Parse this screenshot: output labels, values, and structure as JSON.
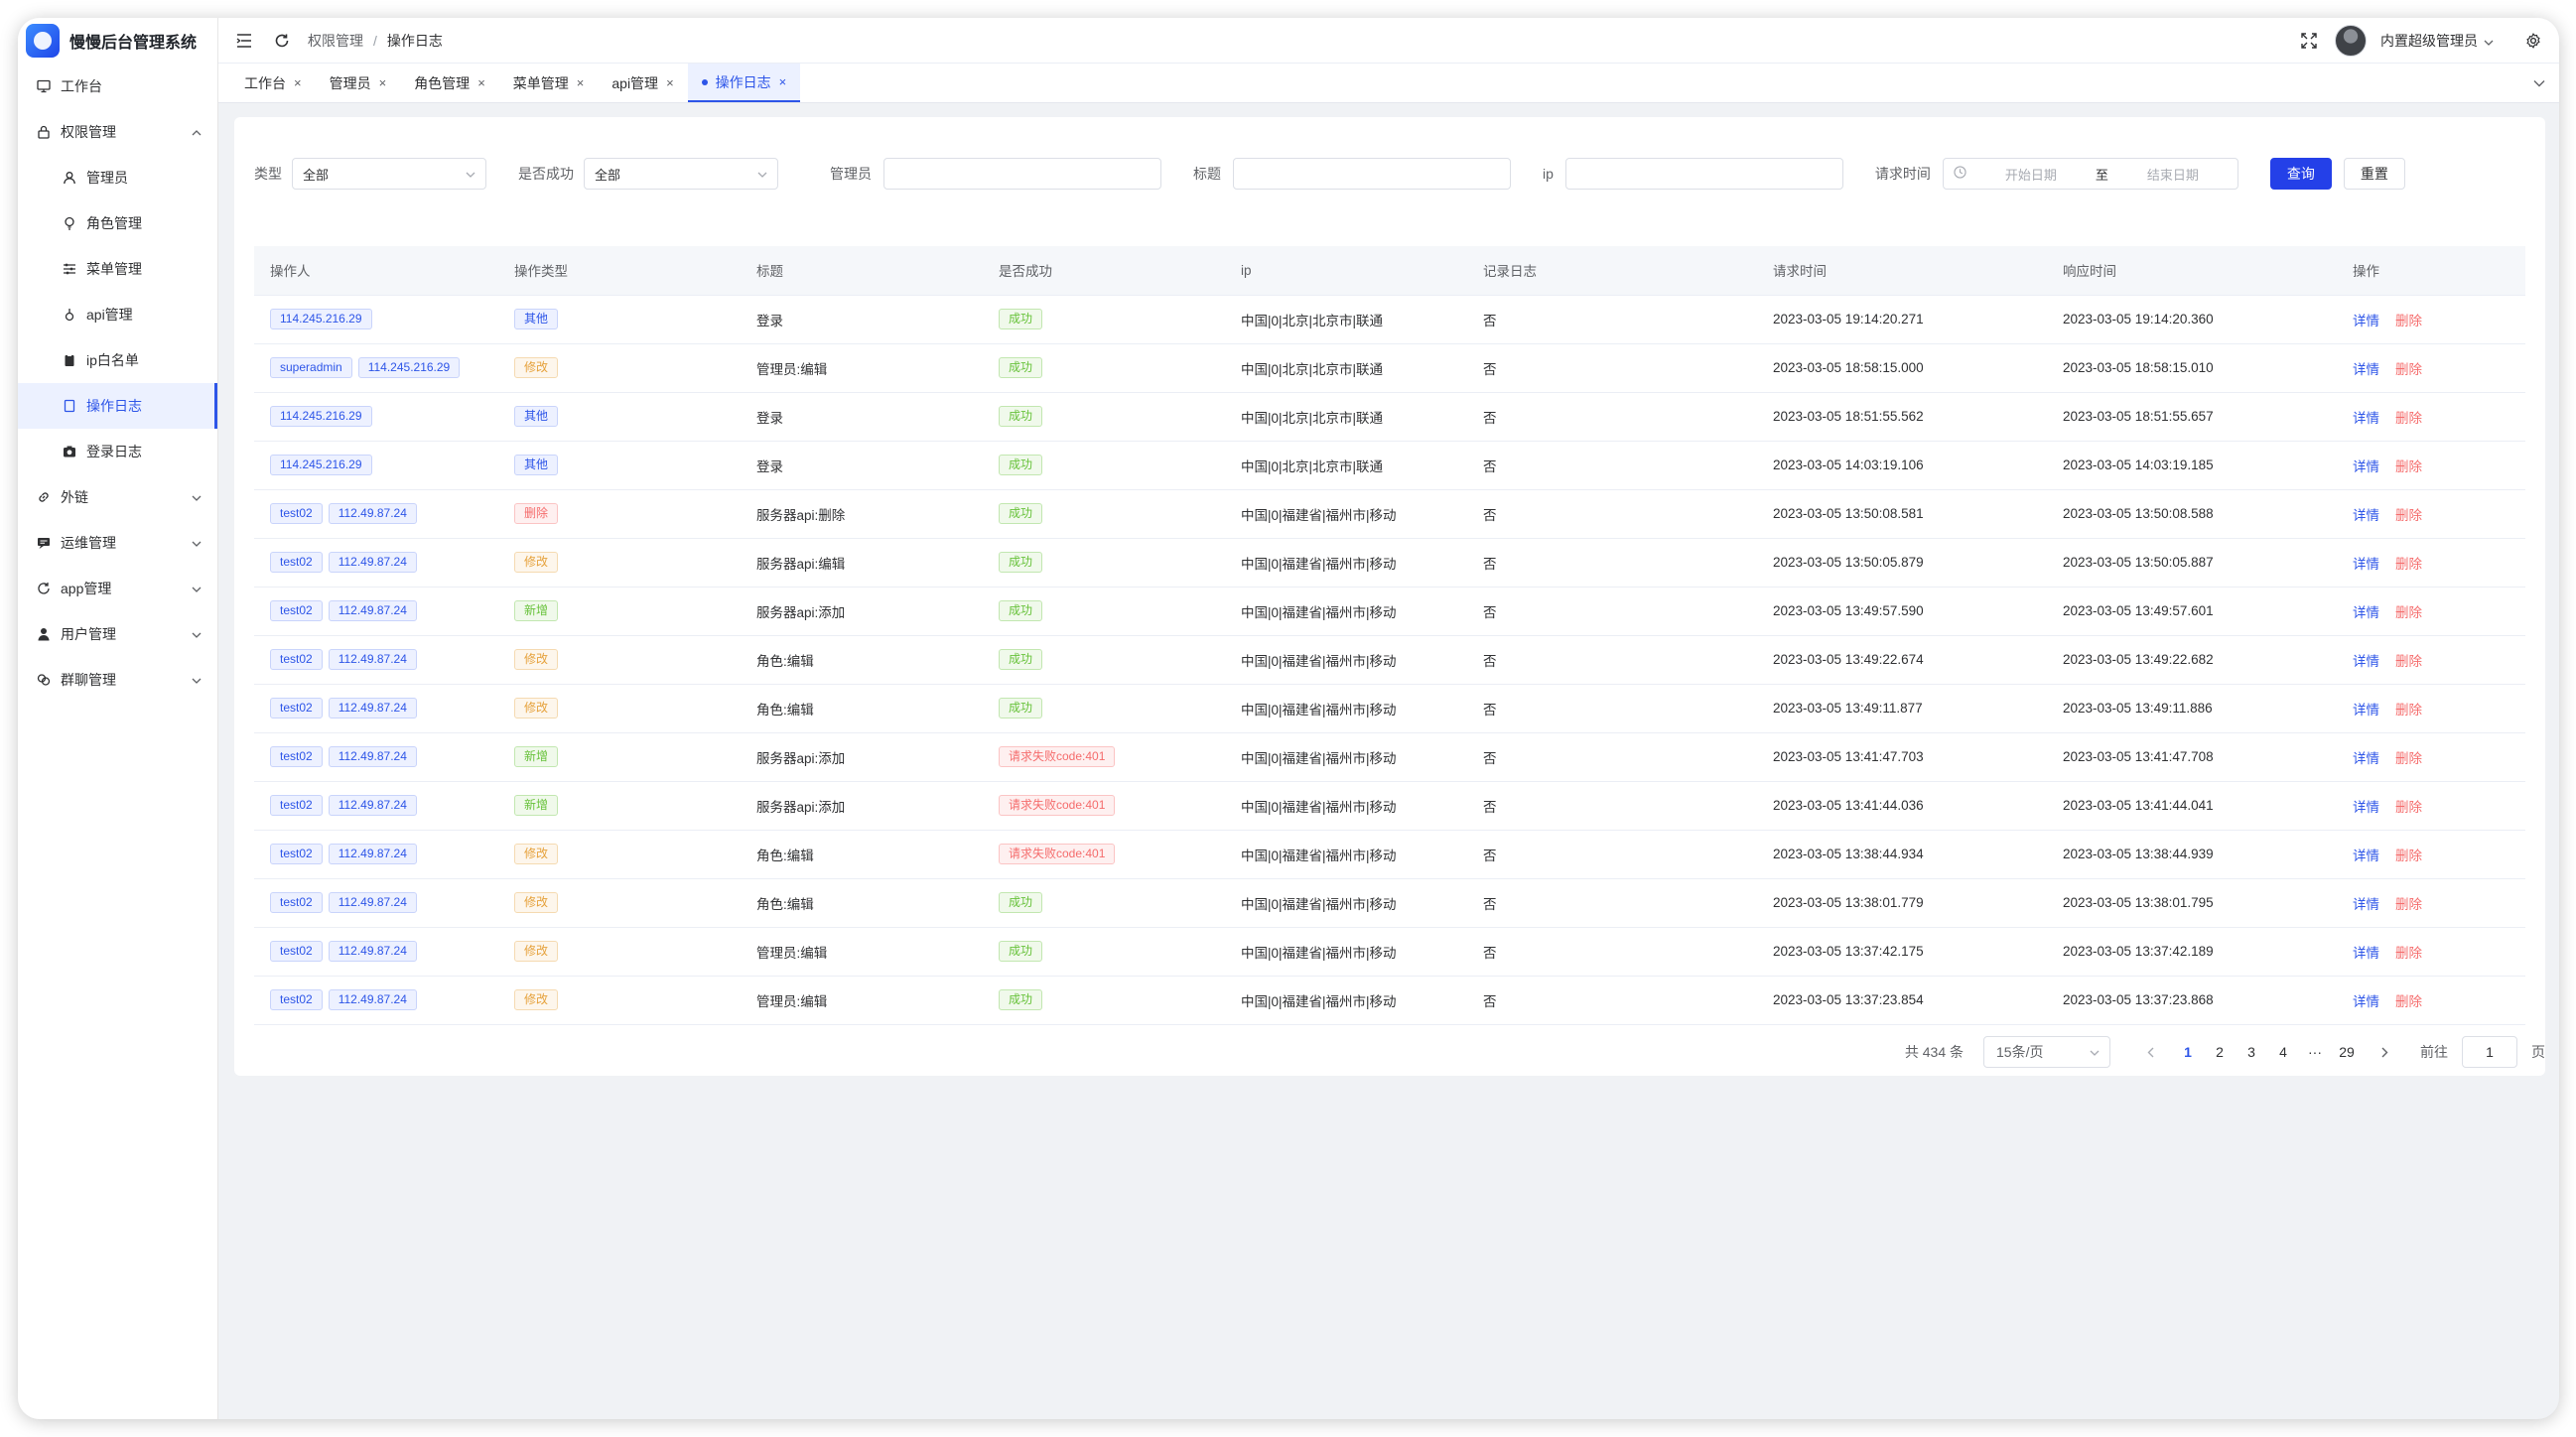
{
  "app": {
    "brand": "慢慢后台管理系统",
    "accent": "#2d55e8"
  },
  "sidebar": {
    "items": [
      {
        "label": "工作台",
        "icon": "monitor-icon",
        "level": 0,
        "active": false,
        "expandable": false
      },
      {
        "label": "权限管理",
        "icon": "lock-icon",
        "level": 0,
        "active": false,
        "expandable": true,
        "expanded": true
      },
      {
        "label": "管理员",
        "icon": "user-icon",
        "level": 1,
        "active": false
      },
      {
        "label": "角色管理",
        "icon": "bulb-icon",
        "level": 1,
        "active": false
      },
      {
        "label": "菜单管理",
        "icon": "sliders-icon",
        "level": 1,
        "active": false
      },
      {
        "label": "api管理",
        "icon": "pin-icon",
        "level": 1,
        "active": false
      },
      {
        "label": "ip白名单",
        "icon": "clipboard-icon",
        "level": 1,
        "active": false
      },
      {
        "label": "操作日志",
        "icon": "document-icon",
        "level": 1,
        "active": true
      },
      {
        "label": "登录日志",
        "icon": "camera-icon",
        "level": 1,
        "active": false
      },
      {
        "label": "外链",
        "icon": "link-icon",
        "level": 0,
        "active": false,
        "expandable": true
      },
      {
        "label": "运维管理",
        "icon": "message-icon",
        "level": 0,
        "active": false,
        "expandable": true
      },
      {
        "label": "app管理",
        "icon": "refresh-icon",
        "level": 0,
        "active": false,
        "expandable": true
      },
      {
        "label": "用户管理",
        "icon": "person-icon",
        "level": 0,
        "active": false,
        "expandable": true
      },
      {
        "label": "群聊管理",
        "icon": "chat-icon",
        "level": 0,
        "active": false,
        "expandable": true
      }
    ]
  },
  "header": {
    "breadcrumb": [
      "权限管理",
      "操作日志"
    ],
    "user": "内置超级管理员"
  },
  "tabs": [
    {
      "label": "工作台",
      "active": false
    },
    {
      "label": "管理员",
      "active": false
    },
    {
      "label": "角色管理",
      "active": false
    },
    {
      "label": "菜单管理",
      "active": false
    },
    {
      "label": "api管理",
      "active": false
    },
    {
      "label": "操作日志",
      "active": true
    }
  ],
  "filters": {
    "type_label": "类型",
    "type_value": "全部",
    "success_label": "是否成功",
    "success_value": "全部",
    "admin_label": "管理员",
    "admin_value": "",
    "title_label": "标题",
    "title_value": "",
    "ip_label": "ip",
    "ip_value": "",
    "time_label": "请求时间",
    "start_placeholder": "开始日期",
    "to": "至",
    "end_placeholder": "结束日期",
    "query_label": "查询",
    "reset_label": "重置"
  },
  "table": {
    "columns": [
      "操作人",
      "操作类型",
      "标题",
      "是否成功",
      "ip",
      "记录日志",
      "请求时间",
      "响应时间",
      "操作"
    ],
    "detail_label": "详情",
    "delete_label": "删除",
    "rows": [
      {
        "user": "",
        "ip": "114.245.216.29",
        "type": "其他",
        "type_color": "purple",
        "title": "登录",
        "success": "成功",
        "success_color": "green",
        "location": "中国|0|北京|北京市|联通",
        "log": "否",
        "req": "2023-03-05 19:14:20.271",
        "resp": "2023-03-05 19:14:20.360"
      },
      {
        "user": "superadmin",
        "ip": "114.245.216.29",
        "type": "修改",
        "type_color": "orange",
        "title": "管理员:编辑",
        "success": "成功",
        "success_color": "green",
        "location": "中国|0|北京|北京市|联通",
        "log": "否",
        "req": "2023-03-05 18:58:15.000",
        "resp": "2023-03-05 18:58:15.010"
      },
      {
        "user": "",
        "ip": "114.245.216.29",
        "type": "其他",
        "type_color": "purple",
        "title": "登录",
        "success": "成功",
        "success_color": "green",
        "location": "中国|0|北京|北京市|联通",
        "log": "否",
        "req": "2023-03-05 18:51:55.562",
        "resp": "2023-03-05 18:51:55.657"
      },
      {
        "user": "",
        "ip": "114.245.216.29",
        "type": "其他",
        "type_color": "purple",
        "title": "登录",
        "success": "成功",
        "success_color": "green",
        "location": "中国|0|北京|北京市|联通",
        "log": "否",
        "req": "2023-03-05 14:03:19.106",
        "resp": "2023-03-05 14:03:19.185"
      },
      {
        "user": "test02",
        "ip": "112.49.87.24",
        "type": "删除",
        "type_color": "red",
        "title": "服务器api:删除",
        "success": "成功",
        "success_color": "green",
        "location": "中国|0|福建省|福州市|移动",
        "log": "否",
        "req": "2023-03-05 13:50:08.581",
        "resp": "2023-03-05 13:50:08.588"
      },
      {
        "user": "test02",
        "ip": "112.49.87.24",
        "type": "修改",
        "type_color": "orange",
        "title": "服务器api:编辑",
        "success": "成功",
        "success_color": "green",
        "location": "中国|0|福建省|福州市|移动",
        "log": "否",
        "req": "2023-03-05 13:50:05.879",
        "resp": "2023-03-05 13:50:05.887"
      },
      {
        "user": "test02",
        "ip": "112.49.87.24",
        "type": "新增",
        "type_color": "green",
        "title": "服务器api:添加",
        "success": "成功",
        "success_color": "green",
        "location": "中国|0|福建省|福州市|移动",
        "log": "否",
        "req": "2023-03-05 13:49:57.590",
        "resp": "2023-03-05 13:49:57.601"
      },
      {
        "user": "test02",
        "ip": "112.49.87.24",
        "type": "修改",
        "type_color": "orange",
        "title": "角色:编辑",
        "success": "成功",
        "success_color": "green",
        "location": "中国|0|福建省|福州市|移动",
        "log": "否",
        "req": "2023-03-05 13:49:22.674",
        "resp": "2023-03-05 13:49:22.682"
      },
      {
        "user": "test02",
        "ip": "112.49.87.24",
        "type": "修改",
        "type_color": "orange",
        "title": "角色:编辑",
        "success": "成功",
        "success_color": "green",
        "location": "中国|0|福建省|福州市|移动",
        "log": "否",
        "req": "2023-03-05 13:49:11.877",
        "resp": "2023-03-05 13:49:11.886"
      },
      {
        "user": "test02",
        "ip": "112.49.87.24",
        "type": "新增",
        "type_color": "green",
        "title": "服务器api:添加",
        "success": "请求失败code:401",
        "success_color": "red",
        "location": "中国|0|福建省|福州市|移动",
        "log": "否",
        "req": "2023-03-05 13:41:47.703",
        "resp": "2023-03-05 13:41:47.708"
      },
      {
        "user": "test02",
        "ip": "112.49.87.24",
        "type": "新增",
        "type_color": "green",
        "title": "服务器api:添加",
        "success": "请求失败code:401",
        "success_color": "red",
        "location": "中国|0|福建省|福州市|移动",
        "log": "否",
        "req": "2023-03-05 13:41:44.036",
        "resp": "2023-03-05 13:41:44.041"
      },
      {
        "user": "test02",
        "ip": "112.49.87.24",
        "type": "修改",
        "type_color": "orange",
        "title": "角色:编辑",
        "success": "请求失败code:401",
        "success_color": "red",
        "location": "中国|0|福建省|福州市|移动",
        "log": "否",
        "req": "2023-03-05 13:38:44.934",
        "resp": "2023-03-05 13:38:44.939"
      },
      {
        "user": "test02",
        "ip": "112.49.87.24",
        "type": "修改",
        "type_color": "orange",
        "title": "角色:编辑",
        "success": "成功",
        "success_color": "green",
        "location": "中国|0|福建省|福州市|移动",
        "log": "否",
        "req": "2023-03-05 13:38:01.779",
        "resp": "2023-03-05 13:38:01.795"
      },
      {
        "user": "test02",
        "ip": "112.49.87.24",
        "type": "修改",
        "type_color": "orange",
        "title": "管理员:编辑",
        "success": "成功",
        "success_color": "green",
        "location": "中国|0|福建省|福州市|移动",
        "log": "否",
        "req": "2023-03-05 13:37:42.175",
        "resp": "2023-03-05 13:37:42.189"
      },
      {
        "user": "test02",
        "ip": "112.49.87.24",
        "type": "修改",
        "type_color": "orange",
        "title": "管理员:编辑",
        "success": "成功",
        "success_color": "green",
        "location": "中国|0|福建省|福州市|移动",
        "log": "否",
        "req": "2023-03-05 13:37:23.854",
        "resp": "2023-03-05 13:37:23.868"
      }
    ]
  },
  "pagination": {
    "total": "共 434 条",
    "page_size": "15条/页",
    "pages": [
      "1",
      "2",
      "3",
      "4",
      "···",
      "29"
    ],
    "current": "1",
    "goto_label": "前往",
    "goto_value": "1",
    "page_suffix": "页"
  }
}
